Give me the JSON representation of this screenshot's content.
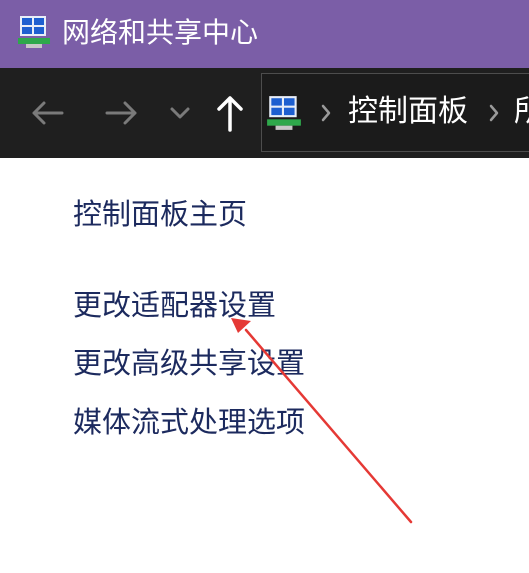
{
  "window": {
    "title": "网络和共享中心",
    "title_icon": "network-sharing-center-icon"
  },
  "navigation": {
    "back_icon": "back-arrow-icon",
    "forward_icon": "forward-arrow-icon",
    "recent_icon": "chevron-down-icon",
    "up_icon": "up-arrow-icon"
  },
  "address_bar": {
    "location_icon": "control-panel-icon",
    "separator_icon": "chevron-right-icon",
    "crumbs": [
      {
        "label": "控制面板"
      },
      {
        "label": "所"
      }
    ]
  },
  "sidebar": {
    "home_link": "控制面板主页",
    "links": [
      {
        "label": "更改适配器设置"
      },
      {
        "label": "更改高级共享设置"
      },
      {
        "label": "媒体流式处理选项"
      }
    ]
  },
  "annotation": {
    "arrow_icon": "red-annotation-arrow",
    "color": "#e53935"
  },
  "colors": {
    "titlebar": "#7b5ea7",
    "navbar": "#1f1f1f",
    "link": "#1c2a5e"
  }
}
